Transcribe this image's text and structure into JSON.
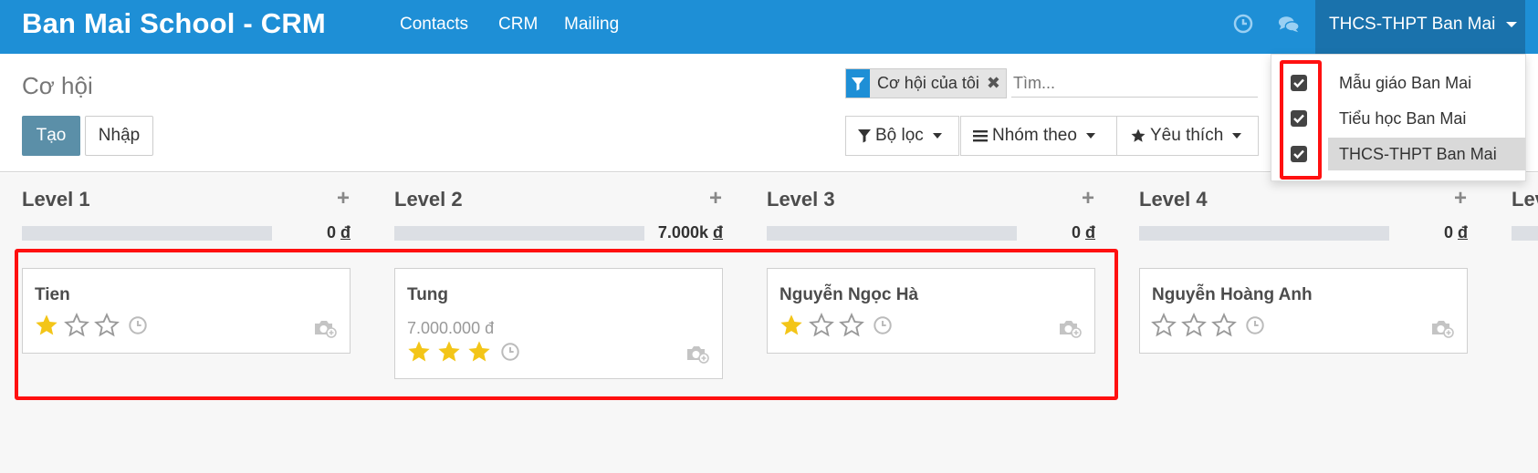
{
  "app": {
    "title": "Ban Mai School - CRM"
  },
  "nav": {
    "items": [
      "Contacts",
      "CRM",
      "Mailing"
    ]
  },
  "topbar": {
    "icons": [
      "clock-icon",
      "chat-icon"
    ],
    "company_switcher": "THCS-THPT Ban Mai"
  },
  "company_dropdown": {
    "items": [
      {
        "label": "Mẫu giáo Ban Mai",
        "checked": true
      },
      {
        "label": "Tiểu học Ban Mai",
        "checked": true
      },
      {
        "label": "THCS-THPT Ban Mai",
        "checked": true,
        "active": true
      }
    ]
  },
  "control_panel": {
    "title": "Cơ hội",
    "create_label": "Tạo",
    "import_label": "Nhập",
    "facet": "Cơ hội của tôi",
    "search_placeholder": "Tìm...",
    "filters_label": "Bộ lọc",
    "groupby_label": "Nhóm theo",
    "favorites_label": "Yêu thích"
  },
  "kanban": {
    "columns": [
      {
        "title": "Level 1",
        "total": "0",
        "currency": "đ",
        "card": {
          "name": "Tien",
          "amount": "",
          "stars": 1
        }
      },
      {
        "title": "Level 2",
        "total": "7.000k",
        "currency": "đ",
        "card": {
          "name": "Tung",
          "amount": "7.000.000 đ",
          "stars": 3
        }
      },
      {
        "title": "Level 3",
        "total": "0",
        "currency": "đ",
        "card": {
          "name": "Nguyễn Ngọc Hà",
          "amount": "",
          "stars": 1
        }
      },
      {
        "title": "Level 4",
        "total": "0",
        "currency": "đ",
        "card": {
          "name": "Nguyễn Hoàng Anh",
          "amount": "",
          "stars": 0
        }
      },
      {
        "title": "Lev"
      }
    ]
  },
  "colors": {
    "navbar": "#1e8fd6",
    "company_switch_bg": "#1a72ac",
    "primary_button": "#5b8fa8",
    "star_filled": "#f3c518",
    "highlight": "#ff1010"
  }
}
